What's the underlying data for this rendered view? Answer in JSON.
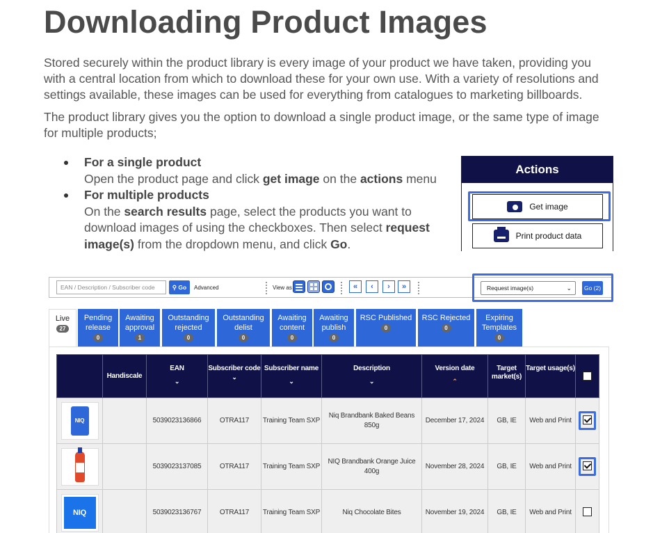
{
  "title": "Downloading Product Images",
  "intro": [
    "Stored securely within the product library is every image of your product we have taken, providing you with a central location from which to download these for your own use. With a variety of resolutions and settings available, these images can be used for everything from catalogues to marketing billboards.",
    "The product library gives you the option to download a single product image, or the same type of image for multiple products;"
  ],
  "bullets": [
    {
      "heading": "For a single product",
      "parts": [
        "Open the product page and click ",
        "get image",
        " on the ",
        "actions",
        " menu"
      ]
    },
    {
      "heading": "For multiple products",
      "parts": [
        "On the ",
        "search results",
        " page, select the products you want to download images of using the checkboxes. Then select ",
        "request image(s)",
        " from the dropdown menu, and click ",
        "Go",
        "."
      ]
    }
  ],
  "actions_panel": {
    "title": "Actions",
    "get_image": "Get image",
    "print_product_data": "Print product data"
  },
  "toolbar": {
    "search_placeholder": "EAN / Description / Subscriber code",
    "go_label": "Go",
    "advanced_label": "Advanced",
    "view_as_label": "View as",
    "pager": [
      "«",
      "‹",
      "›",
      "»"
    ],
    "request_select_value": "Request image(s)",
    "go_selected_label": "Go (2)"
  },
  "tabs": [
    {
      "label": "Live",
      "count": "27"
    },
    {
      "label": "Pending release",
      "count": "0"
    },
    {
      "label": "Awaiting approval",
      "count": "1"
    },
    {
      "label": "Outstanding rejected",
      "count": "0"
    },
    {
      "label": "Outstanding delist",
      "count": "0"
    },
    {
      "label": "Awaiting content",
      "count": "0"
    },
    {
      "label": "Awaiting publish",
      "count": "0"
    },
    {
      "label": "RSC Published",
      "count": "0"
    },
    {
      "label": "RSC Rejected",
      "count": "0"
    },
    {
      "label": "Expiring Templates",
      "count": "0"
    }
  ],
  "table": {
    "headers": [
      "",
      "Handiscale",
      "EAN",
      "Subscriber code",
      "Subscriber name",
      "Description",
      "Version date",
      "Target market(s)",
      "Target usage(s)",
      ""
    ],
    "rows": [
      {
        "thumb_text": "NIQ",
        "ean": "5039023136866",
        "sub_code": "OTRA117",
        "sub_name": "Training Team SXP",
        "description": "Niq Brandbank Baked Beans 850g",
        "version_date": "December 17, 2024",
        "markets": "GB, IE",
        "usage": "Web and Print",
        "checked": true
      },
      {
        "thumb_text": "",
        "ean": "5039023137085",
        "sub_code": "OTRA117",
        "sub_name": "Training Team SXP",
        "description": "NIQ Brandbank Orange Juice 400g",
        "version_date": "November 28, 2024",
        "markets": "GB, IE",
        "usage": "Web and Print",
        "checked": true
      },
      {
        "thumb_text": "NIQ",
        "ean": "5039023136767",
        "sub_code": "OTRA117",
        "sub_name": "Training Team SXP",
        "description": "Niq Chocolate Bites",
        "version_date": "November 19, 2024",
        "markets": "GB, IE",
        "usage": "Web and Print",
        "checked": false
      }
    ]
  },
  "colors": {
    "navy": "#0f1147",
    "blue": "#2d67d8",
    "highlight": "#3b6de0",
    "sort_active": "#f7a24a"
  }
}
